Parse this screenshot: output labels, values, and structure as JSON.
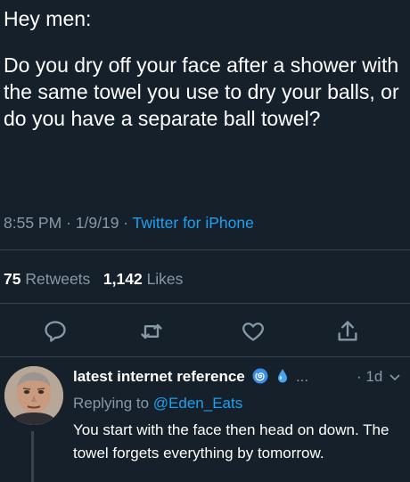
{
  "tweet": {
    "greeting": "Hey men:",
    "body": "Do you dry off your face after a shower with the same towel you use to dry your balls, or do you have a separate ball towel?",
    "time": "8:55 PM",
    "date": "1/9/19",
    "separator": "·",
    "source": "Twitter for iPhone"
  },
  "stats": {
    "retweets_count": "75",
    "retweets_label": "Retweets",
    "likes_count": "1,142",
    "likes_label": "Likes"
  },
  "actions": [
    {
      "icon": "reply-icon"
    },
    {
      "icon": "retweet-icon"
    },
    {
      "icon": "heart-icon"
    },
    {
      "icon": "share-icon"
    }
  ],
  "reply": {
    "display_name": "latest internet reference",
    "badges": [
      "spiral-emoji-icon",
      "droplet-emoji-icon"
    ],
    "ellipsis": "...",
    "time_ago": "· 1d",
    "replying_prefix": "Replying to",
    "replying_handle": "@Eden_Eats",
    "text": "You start with the face then head on down. The towel forgets everything by tomorrow."
  },
  "colors": {
    "background": "#15202b",
    "text": "#ffffff",
    "muted": "#8899a6",
    "accent": "#1da1f2",
    "divider": "#38444d"
  }
}
